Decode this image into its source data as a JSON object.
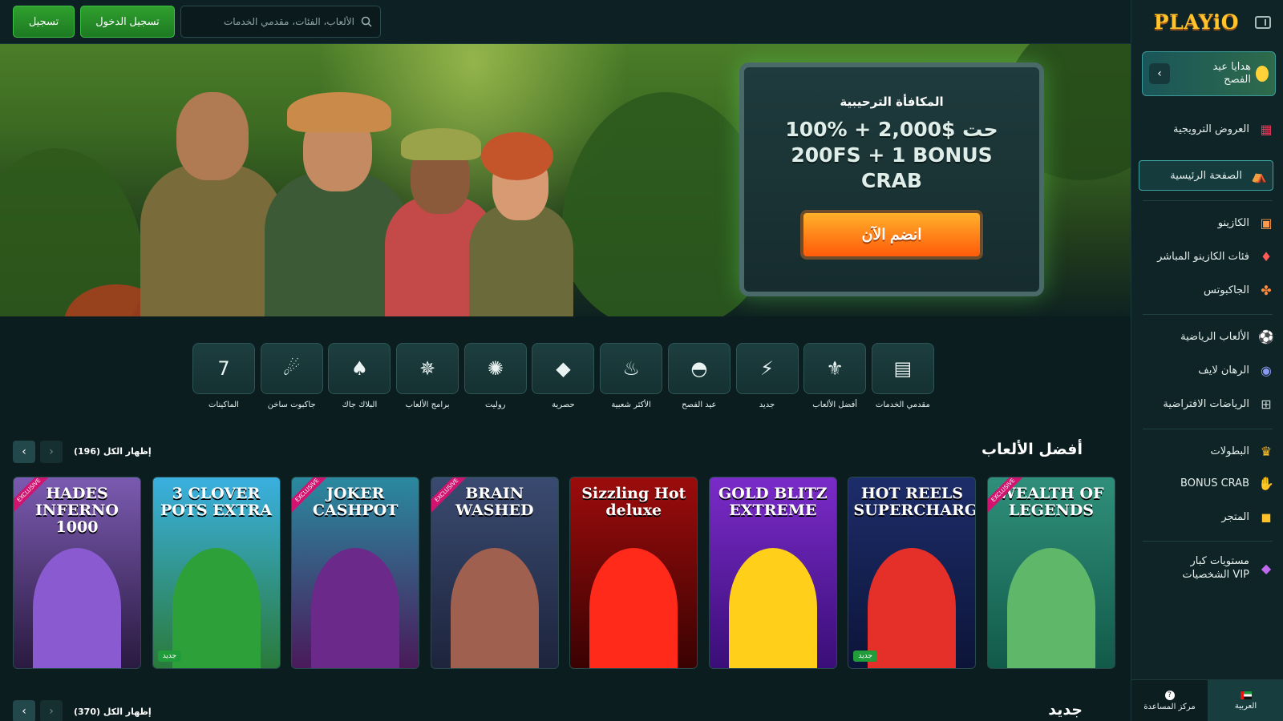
{
  "header": {
    "register_label": "تسجيل",
    "login_label": "تسجيل الدخول",
    "search_placeholder": "الألعاب، الفئات، مقدمي الخدمات"
  },
  "sidebar": {
    "logo": "PLAYiO",
    "easter_label": "هدايا عيد الفصح",
    "items": [
      {
        "label": "العروض الترويجية",
        "icon": "gift-icon"
      },
      {
        "label": "الصفحة الرئيسية",
        "icon": "home-icon"
      },
      {
        "label": "الكازينو",
        "icon": "slot-machine-icon"
      },
      {
        "label": "فئات الكازينو المباشر",
        "icon": "cards-icon"
      },
      {
        "label": "الجاكبوتس",
        "icon": "clover-icon"
      },
      {
        "label": "الألعاب الرياضية",
        "icon": "football-icon"
      },
      {
        "label": "الرهان لايف",
        "icon": "live-icon"
      },
      {
        "label": "الرياضات الافتراضية",
        "icon": "gamepad-icon"
      },
      {
        "label": "البطولات",
        "icon": "trophy-icon"
      },
      {
        "label": "BONUS CRAB",
        "icon": "crab-icon"
      },
      {
        "label": "المتجر",
        "icon": "shop-bag-icon"
      },
      {
        "label": "مستويات كبار الشخصيات VIP",
        "icon": "diamond-icon"
      }
    ],
    "lang_label": "العربية",
    "help_label": "مركز المساعدة"
  },
  "banner": {
    "title": "المكافأة الترحيبية",
    "offer": "100% حت $2,000 + 200FS + 1 BONUS CRAB",
    "cta": "انضم الآن"
  },
  "categories": [
    {
      "label": "مقدمي الخدمات",
      "icon": "providers-icon",
      "glyph": "▤"
    },
    {
      "label": "أفضل الألعاب",
      "icon": "fleur-icon",
      "glyph": "⚜"
    },
    {
      "label": "جديد",
      "icon": "lightning-icon",
      "glyph": "⚡"
    },
    {
      "label": "عيد الفصح",
      "icon": "egg-icon",
      "glyph": "◓"
    },
    {
      "label": "الأكثر شعبية",
      "icon": "flame-icon",
      "glyph": "♨"
    },
    {
      "label": "حصرية",
      "icon": "gem-icon",
      "glyph": "◆"
    },
    {
      "label": "روليت",
      "icon": "roulette-icon",
      "glyph": "✺"
    },
    {
      "label": "برامج الألعاب",
      "icon": "wheel-icon",
      "glyph": "✵"
    },
    {
      "label": "البلاك جاك",
      "icon": "spade-icon",
      "glyph": "♠"
    },
    {
      "label": "جاكبوت ساخن",
      "icon": "hot-jackpot-icon",
      "glyph": "☄"
    },
    {
      "label": "الماكينات",
      "icon": "slot-777-icon",
      "glyph": "7"
    }
  ],
  "top_games": {
    "title": "أفضل الألعاب",
    "show_all": "إظهار الكل (196)",
    "games": [
      {
        "name": "WEALTH OF LEGENDS",
        "exclusive": true,
        "new": false,
        "bg": "#2f8f7a",
        "bg2": "#125a4a",
        "art": "#5fb86a"
      },
      {
        "name": "HOT REELS SUPERCHARGED",
        "exclusive": false,
        "new": true,
        "bg": "#1d2d6a",
        "bg2": "#0c1438",
        "art": "#e5302a"
      },
      {
        "name": "GOLD BLITZ EXTREME",
        "exclusive": false,
        "new": false,
        "bg": "#7a2bc8",
        "bg2": "#3a0e78",
        "art": "#ffcf1a"
      },
      {
        "name": "Sizzling Hot deluxe",
        "exclusive": false,
        "new": false,
        "bg": "#9c0c0c",
        "bg2": "#3a0202",
        "art": "#ff2a1a"
      },
      {
        "name": "BRAIN WASHED",
        "exclusive": true,
        "new": false,
        "bg": "#3a4a70",
        "bg2": "#1d243c",
        "art": "#a06050"
      },
      {
        "name": "JOKER CASHPOT",
        "exclusive": true,
        "new": false,
        "bg": "#2a8aa0",
        "bg2": "#4a1a5a",
        "art": "#6b2a8a"
      },
      {
        "name": "3 CLOVER POTS EXTRA",
        "exclusive": false,
        "new": true,
        "bg": "#3ab0e0",
        "bg2": "#2a7a3a",
        "art": "#2ea03a"
      },
      {
        "name": "HADES INFERNO 1000",
        "exclusive": true,
        "new": false,
        "bg": "#7a5ab0",
        "bg2": "#2a1a40",
        "art": "#8a5ad0"
      }
    ],
    "new_badge": "جديد",
    "exclusive_badge": "EXCLUSIVE"
  },
  "new_games": {
    "title": "جديد",
    "show_all": "إظهار الكل (370)"
  }
}
